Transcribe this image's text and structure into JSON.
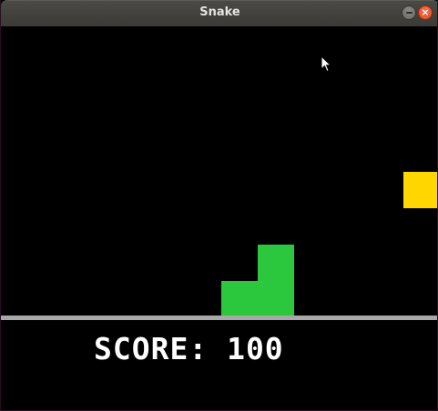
{
  "window": {
    "title": "Snake",
    "minimize_icon": "minimize-icon",
    "close_icon": "close-icon",
    "close_glyph": "×"
  },
  "game": {
    "snake_color": "#2bc83e",
    "food_color": "#ffd600",
    "background_color": "#000000",
    "divider_color": "#a8a8a8",
    "score_text": "SCORE: 100"
  }
}
